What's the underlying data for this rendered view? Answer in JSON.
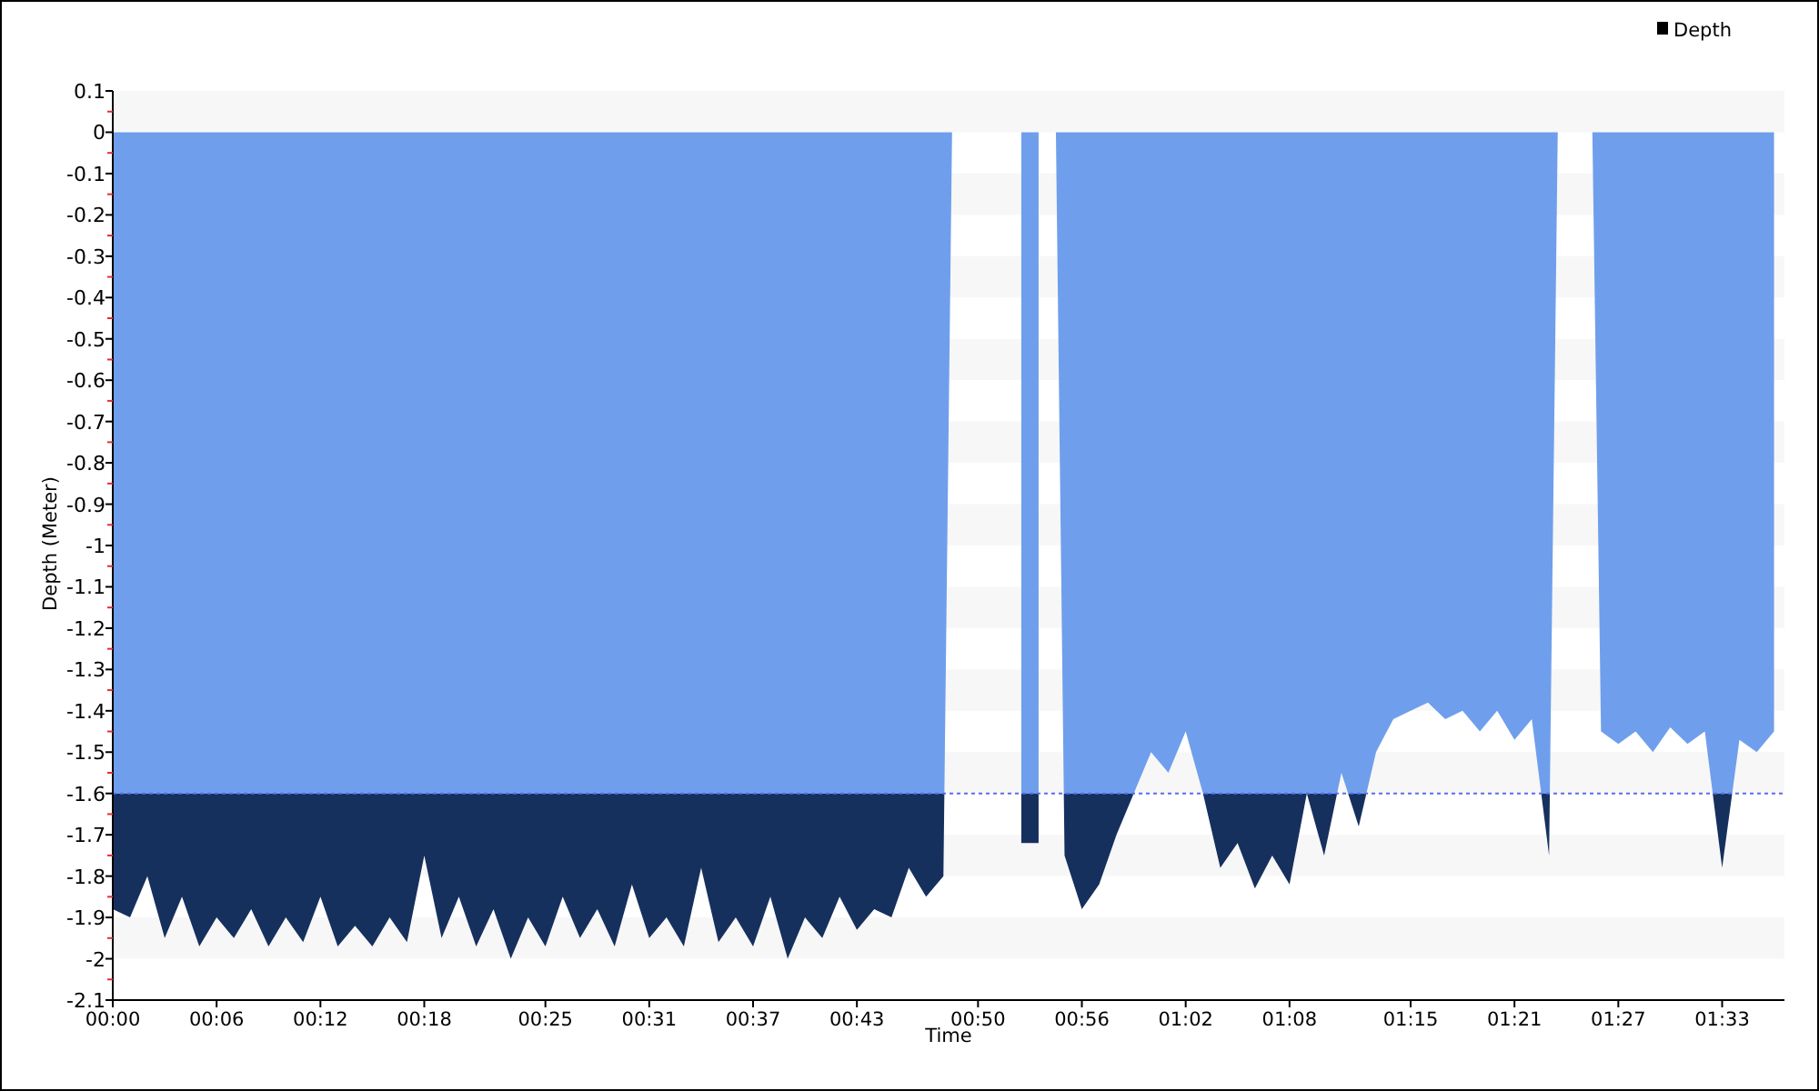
{
  "chart": {
    "chart_data": {
      "type": "area",
      "xlabel": "Time",
      "ylabel": "Depth (Meter)",
      "xlim": [
        0,
        96.6
      ],
      "ylim": [
        -2.1,
        0.1
      ],
      "x": [
        0,
        1,
        2,
        3,
        4,
        5,
        6,
        7,
        8,
        9,
        10,
        11,
        12,
        13,
        14,
        15,
        16,
        17,
        18,
        19,
        20,
        21,
        22,
        23,
        24,
        25,
        26,
        27,
        28,
        29,
        30,
        31,
        32,
        33,
        34,
        35,
        36,
        37,
        38,
        39,
        40,
        41,
        42,
        43,
        44,
        45,
        46,
        47,
        48,
        49,
        50,
        51,
        52,
        53,
        54,
        55,
        56,
        57,
        58,
        59,
        60,
        61,
        62,
        63,
        64,
        65,
        66,
        67,
        68,
        69,
        70,
        71,
        72,
        73,
        74,
        75,
        76,
        77,
        78,
        79,
        80,
        81,
        82,
        83,
        84,
        85,
        86,
        87,
        88,
        89,
        90,
        91,
        92,
        93,
        94,
        95,
        96
      ],
      "series": [
        {
          "name": "Depth",
          "color": "#6f9fec",
          "values": [
            -1.88,
            -1.9,
            -1.8,
            -1.95,
            -1.85,
            -1.97,
            -1.9,
            -1.95,
            -1.88,
            -1.97,
            -1.9,
            -1.96,
            -1.85,
            -1.97,
            -1.92,
            -1.97,
            -1.9,
            -1.96,
            -1.75,
            -1.95,
            -1.85,
            -1.97,
            -1.88,
            -2.0,
            -1.9,
            -1.97,
            -1.85,
            -1.95,
            -1.88,
            -1.97,
            -1.82,
            -1.95,
            -1.9,
            -1.97,
            -1.78,
            -1.96,
            -1.9,
            -1.97,
            -1.85,
            -2.0,
            -1.9,
            -1.95,
            -1.85,
            -1.93,
            -1.88,
            -1.9,
            -1.78,
            -1.85,
            -1.8,
            null,
            null,
            null,
            null,
            -1.72,
            null,
            -1.75,
            -1.88,
            -1.82,
            -1.7,
            -1.6,
            -1.5,
            -1.55,
            -1.45,
            -1.6,
            -1.78,
            -1.72,
            -1.83,
            -1.75,
            -1.82,
            -1.6,
            -1.75,
            -1.55,
            -1.68,
            -1.5,
            -1.42,
            -1.4,
            -1.38,
            -1.42,
            -1.4,
            -1.45,
            -1.4,
            -1.47,
            -1.42,
            -1.75,
            null,
            null,
            -1.45,
            -1.48,
            -1.45,
            -1.5,
            -1.44,
            -1.48,
            -1.45,
            -1.78,
            -1.47,
            -1.5,
            -1.45
          ]
        }
      ],
      "xticks": [
        {
          "value": 0,
          "label": "00:00"
        },
        {
          "value": 6,
          "label": "00:06"
        },
        {
          "value": 12,
          "label": "00:12"
        },
        {
          "value": 18,
          "label": "00:18"
        },
        {
          "value": 25,
          "label": "00:25"
        },
        {
          "value": 31,
          "label": "00:31"
        },
        {
          "value": 37,
          "label": "00:37"
        },
        {
          "value": 43,
          "label": "00:43"
        },
        {
          "value": 50,
          "label": "00:50"
        },
        {
          "value": 56,
          "label": "00:56"
        },
        {
          "value": 62,
          "label": "01:02"
        },
        {
          "value": 68,
          "label": "01:08"
        },
        {
          "value": 75,
          "label": "01:15"
        },
        {
          "value": 81,
          "label": "01:21"
        },
        {
          "value": 87,
          "label": "01:27"
        },
        {
          "value": 93,
          "label": "01:33"
        }
      ],
      "yticks": [
        0.1,
        0,
        -0.1,
        -0.2,
        -0.3,
        -0.4,
        -0.5,
        -0.6,
        -0.7,
        -0.8,
        -0.9,
        -1,
        -1.1,
        -1.2,
        -1.3,
        -1.4,
        -1.5,
        -1.6,
        -1.7,
        -1.8,
        -1.9,
        -2,
        -2.1
      ],
      "ref_lines": [
        {
          "axis": "y",
          "value": -1.6,
          "color": "#5a6cf0"
        }
      ]
    }
  }
}
